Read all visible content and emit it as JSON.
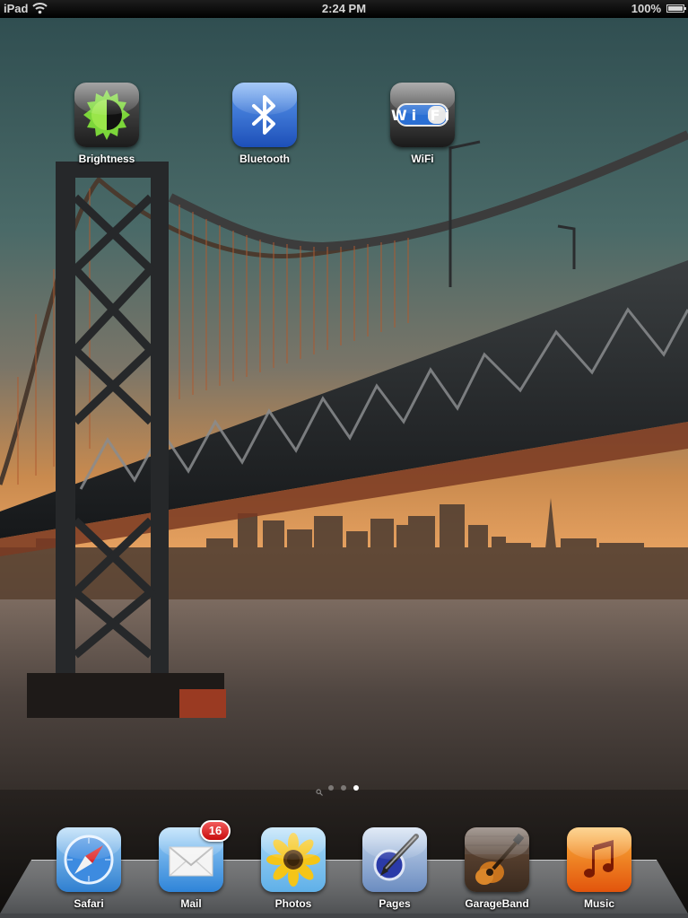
{
  "status_bar": {
    "device": "iPad",
    "time": "2:24 PM",
    "battery_percent": "100%",
    "battery_level": 1.0,
    "wifi_icon": "wifi-signal-icon"
  },
  "home_apps": [
    {
      "label": "Brightness",
      "icon": "brightness-icon"
    },
    {
      "label": "Bluetooth",
      "icon": "bluetooth-icon"
    },
    {
      "label": "WiFi",
      "icon": "wifi-icon",
      "icon_text": "Wi Fi"
    }
  ],
  "page_indicator": {
    "pages": 3,
    "current": 3,
    "search_page": true
  },
  "dock": {
    "apps": [
      {
        "label": "Safari",
        "icon": "compass-icon"
      },
      {
        "label": "Mail",
        "icon": "envelope-icon",
        "badge": "16"
      },
      {
        "label": "Photos",
        "icon": "sunflower-icon"
      },
      {
        "label": "Pages",
        "icon": "pen-icon"
      },
      {
        "label": "GarageBand",
        "icon": "guitar-icon"
      },
      {
        "label": "Music",
        "icon": "music-note-icon"
      }
    ]
  },
  "colors": {
    "badge_red": "#d41414",
    "bluetooth_blue": "#2f6fd6",
    "music_orange": "#f07a16"
  }
}
